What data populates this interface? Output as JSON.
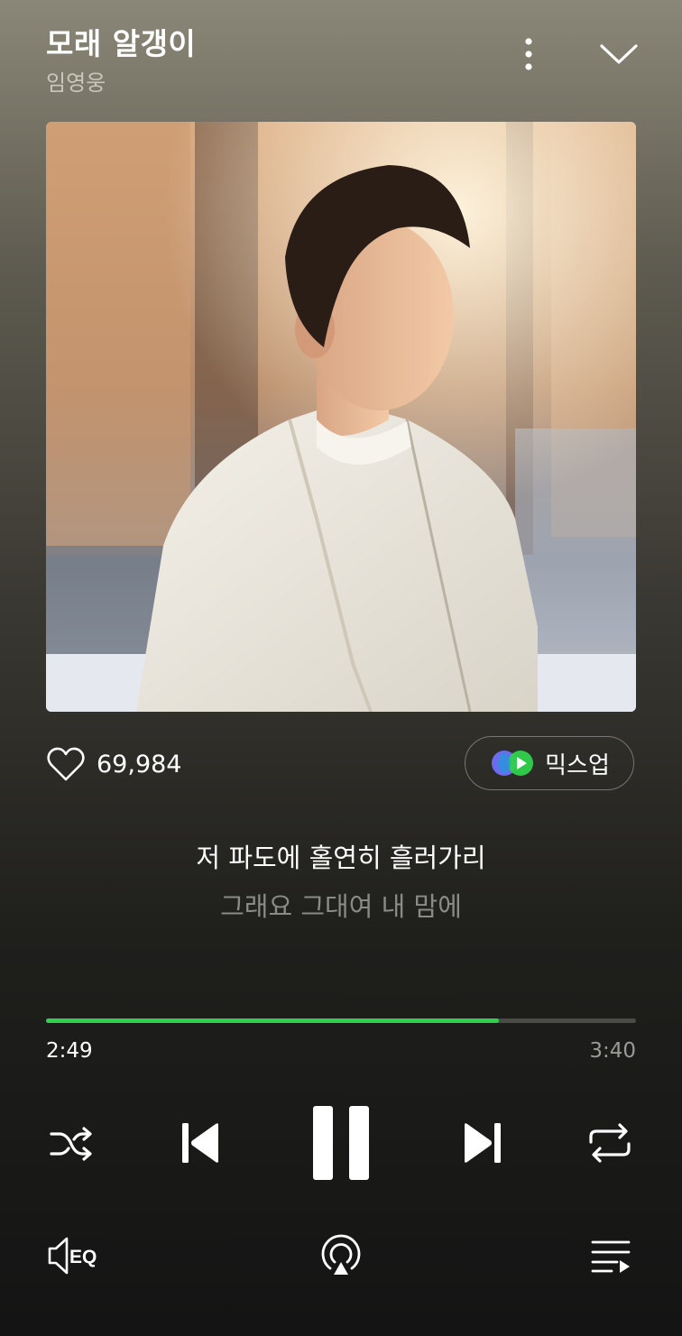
{
  "track": {
    "title": "모래 알갱이",
    "artist": "임영웅"
  },
  "header": {
    "more_icon": "more-vertical-icon",
    "collapse_icon": "chevron-down-icon"
  },
  "like": {
    "count": "69,984",
    "icon": "heart-outline-icon"
  },
  "mixup": {
    "label": "믹스업",
    "icon": "mixup-logo-icon"
  },
  "lyrics": {
    "current": "저 파도에 홀연히 흘러가리",
    "next": "그래요 그대여 내 맘에"
  },
  "playback": {
    "elapsed": "2:49",
    "total": "3:40",
    "progress_fraction": 0.7682,
    "state": "playing"
  },
  "controls": {
    "shuffle_icon": "shuffle-icon",
    "previous_icon": "skip-previous-icon",
    "pause_icon": "pause-icon",
    "next_icon": "skip-next-icon",
    "repeat_icon": "repeat-icon"
  },
  "bottom_bar": {
    "eq_label": "EQ",
    "eq_icon": "eq-icon",
    "cast_icon": "airplay-icon",
    "playlist_icon": "playlist-icon"
  },
  "colors": {
    "accent": "#2fd14c",
    "progress_track": "#4a4a47"
  }
}
